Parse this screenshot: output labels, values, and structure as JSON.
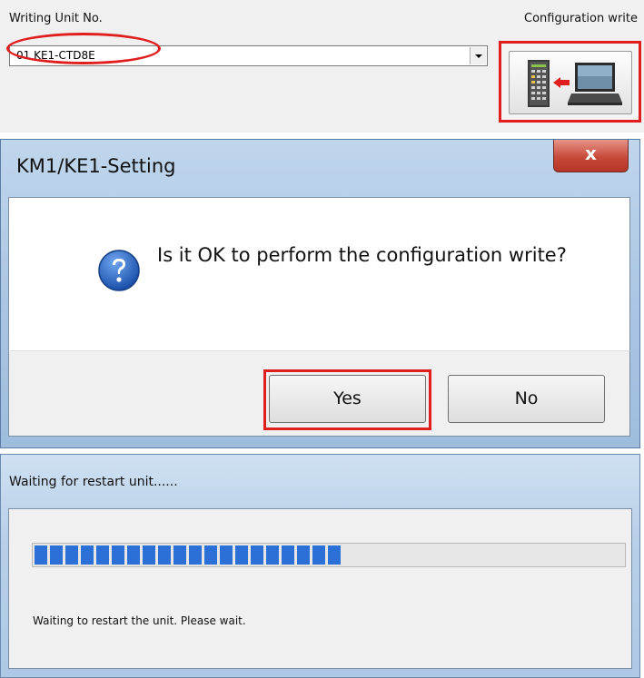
{
  "config_panel": {
    "unit_label": "Writing Unit No.",
    "unit_value": "01 KE1-CTD8E",
    "config_write_label": "Configuration write",
    "config_write_icon": "device-write-icon"
  },
  "dialog": {
    "title": "KM1/KE1-Setting",
    "close_glyph": "x",
    "message": "Is it OK to perform the configuration write?",
    "icon": "question-icon",
    "yes_label": "Yes",
    "no_label": "No"
  },
  "wait_window": {
    "title": "Waiting for restart unit......",
    "progress_percent": 52,
    "message": "Waiting to restart the unit. Please wait."
  },
  "colors": {
    "highlight": "#e01e1e",
    "progress": "#2c6fd6"
  }
}
